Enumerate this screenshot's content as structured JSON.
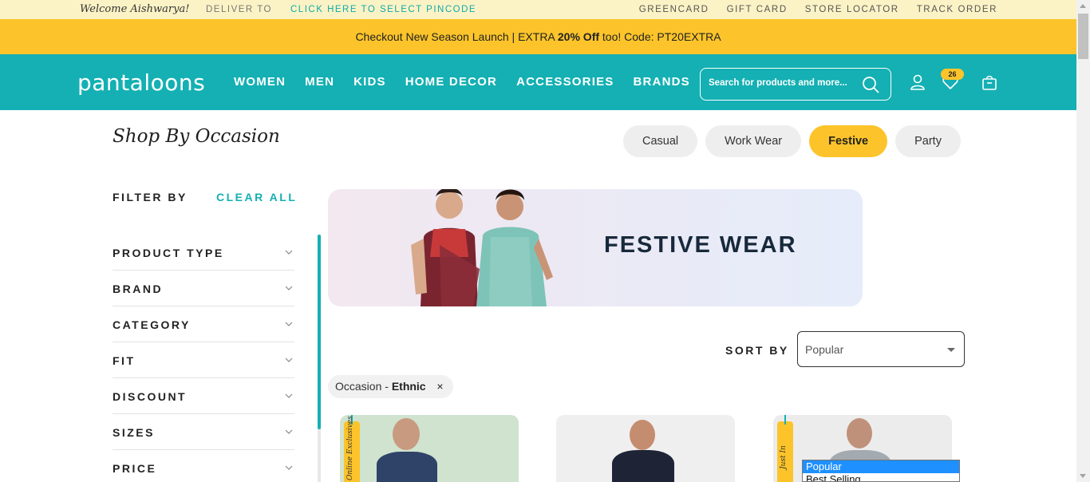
{
  "util_bar": {
    "welcome": "Welcome Aishwarya!",
    "deliver_to": "DELIVER TO",
    "pincode_link": "CLICK HERE TO SELECT PINCODE",
    "links": [
      "GREENCARD",
      "GIFT CARD",
      "STORE LOCATOR",
      "TRACK ORDER"
    ]
  },
  "promo": {
    "prefix": "Checkout New Season Launch | EXTRA ",
    "highlight": "20% Off",
    "suffix": " too! Code: PT20EXTRA"
  },
  "header": {
    "logo": "pantaloons",
    "nav": [
      "WOMEN",
      "MEN",
      "KIDS",
      "HOME DECOR",
      "ACCESSORIES",
      "BRANDS"
    ],
    "search_placeholder": "Search for products and more...",
    "wishlist_count": "26",
    "icons": [
      "search-icon",
      "user-icon",
      "heart-icon",
      "bag-icon"
    ]
  },
  "occasion": {
    "title": "Shop By Occasion",
    "pills": [
      "Casual",
      "Work Wear",
      "Festive",
      "Party"
    ],
    "active": "Festive"
  },
  "filters": {
    "title": "FILTER BY",
    "clear": "CLEAR ALL",
    "items": [
      "PRODUCT TYPE",
      "BRAND",
      "CATEGORY",
      "FIT",
      "DISCOUNT",
      "SIZES",
      "PRICE"
    ]
  },
  "banner": {
    "heading": "FESTIVE WEAR"
  },
  "sort": {
    "label": "SORT BY",
    "selected": "Popular",
    "options": [
      "Popular",
      "Best Selling"
    ]
  },
  "applied_filter": {
    "prefix": "Occasion - ",
    "value": "Ethnic",
    "remove": "×"
  },
  "products": [
    {
      "tag": "Online Exclusives"
    },
    {
      "tag": ""
    },
    {
      "tag": "Just In"
    }
  ],
  "colors": {
    "teal": "#14b0b3",
    "yellow": "#fcc42a",
    "util_bg": "#fbf3c5"
  }
}
